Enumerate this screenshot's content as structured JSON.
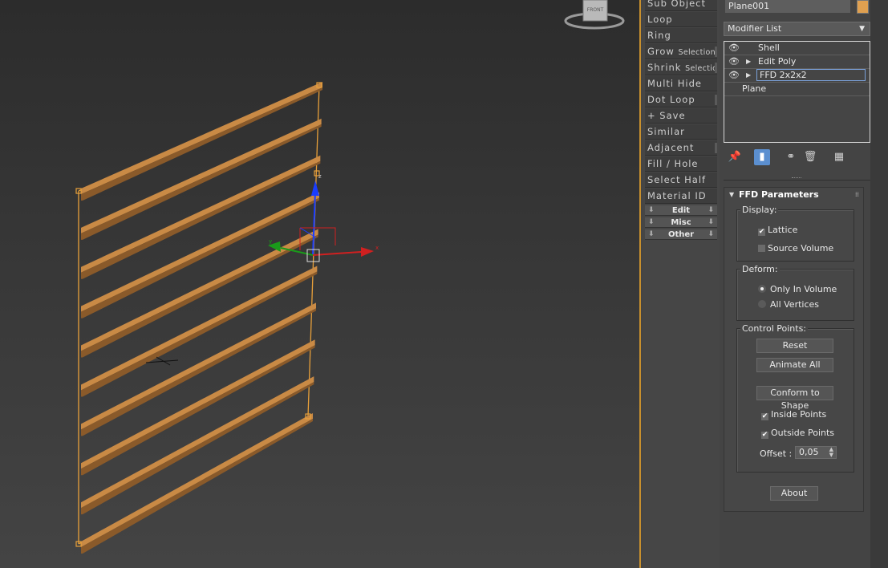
{
  "graphite": {
    "items": [
      {
        "label": "Sub Object",
        "small": ""
      },
      {
        "label": "Loop",
        "small": ""
      },
      {
        "label": "Ring",
        "small": ""
      },
      {
        "label": "Grow",
        "small": "Selection"
      },
      {
        "label": "Shrink",
        "small": "Selection"
      },
      {
        "label": "Multi Hide",
        "small": ""
      },
      {
        "label": "Dot Loop",
        "small": ""
      },
      {
        "label": "+ Save",
        "small": ""
      },
      {
        "label": "Similar",
        "small": ""
      },
      {
        "label": "Adjacent",
        "small": ""
      },
      {
        "label": "Fill / Hole",
        "small": ""
      },
      {
        "label": "Select Half",
        "small": ""
      },
      {
        "label": "Material ID",
        "small": ""
      }
    ],
    "sections": [
      "Edit",
      "Misc",
      "Other"
    ]
  },
  "command_panel": {
    "object_name": "Plane001",
    "object_color": "#e0a050",
    "modifier_list": "Modifier List",
    "stack": [
      {
        "label": "Shell"
      },
      {
        "label": "Edit Poly"
      },
      {
        "label": "FFD 2x2x2"
      },
      {
        "label": "Plane"
      }
    ]
  },
  "ffd": {
    "title": "FFD Parameters",
    "display": {
      "title": "Display:",
      "lattice": "Lattice",
      "lattice_checked": true,
      "source_volume": "Source Volume",
      "source_volume_checked": false
    },
    "deform": {
      "title": "Deform:",
      "only_in_volume": "Only In Volume",
      "all_vertices": "All Vertices",
      "selected": "Only In Volume"
    },
    "control_points": {
      "title": "Control Points:",
      "reset": "Reset",
      "animate_all": "Animate All",
      "conform": "Conform to Shape",
      "inside_points": "Inside Points",
      "inside_checked": true,
      "outside_points": "Outside Points",
      "outside_checked": true,
      "offset_label": "Offset :",
      "offset_value": "0,05"
    },
    "about": "About"
  },
  "viewcube": {
    "label": "FRONT"
  },
  "colors": {
    "slat": "#c98a45",
    "lattice": "#e8a03a",
    "panel_border": "#c8902e",
    "selection_blue": "#5b8fd0"
  }
}
